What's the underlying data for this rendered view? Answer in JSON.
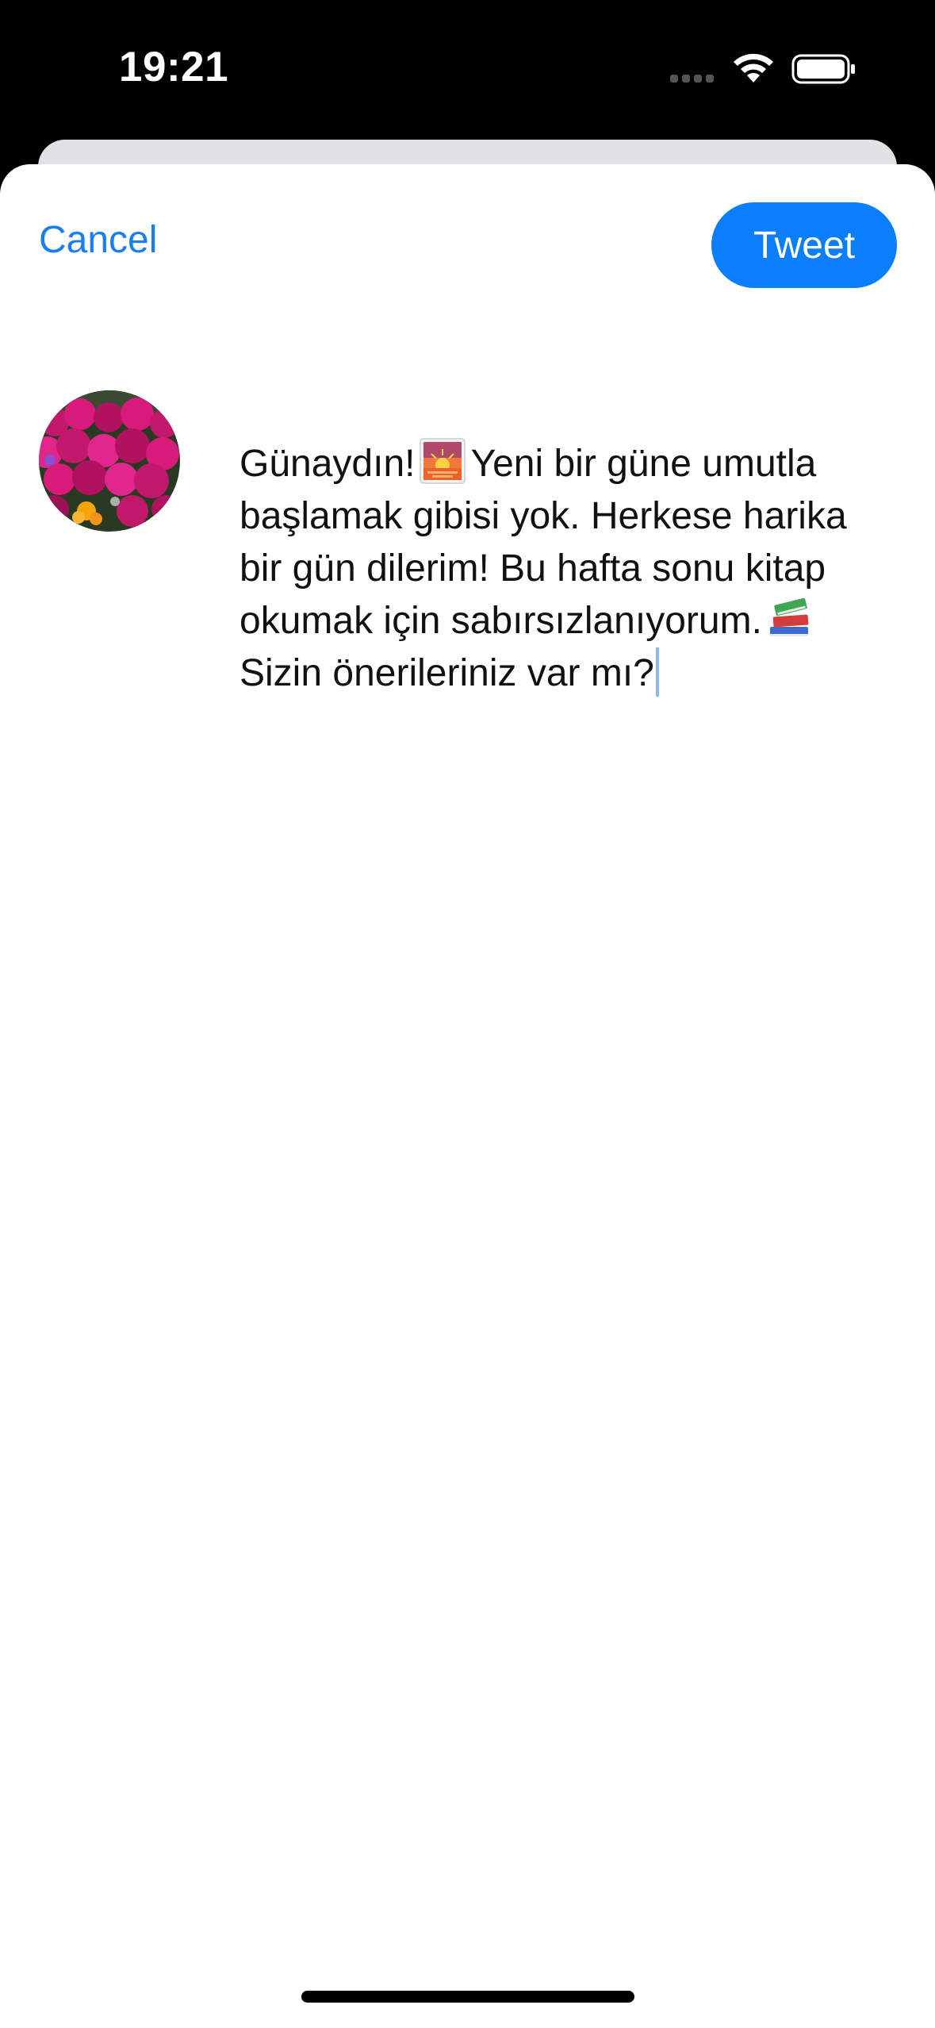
{
  "status_bar": {
    "time": "19:21",
    "icons": [
      "cellular-dots-icon",
      "wifi-icon",
      "battery-icon"
    ]
  },
  "composer": {
    "cancel_label": "Cancel",
    "tweet_label": "Tweet",
    "avatar_icon": "profile-avatar-flowers",
    "text_lines": [
      "Günaydın!",
      "Yeni bir güne umutla",
      "başlamak gibisi yok. Herkese harika",
      "bir gün dilerim! Bu hafta sonu kitap",
      "okumak için sabırsızlanıyorum.",
      "Sizin önerileriniz var mı?"
    ],
    "emojis": [
      "sunrise-emoji",
      "books-emoji"
    ]
  },
  "colors": {
    "accent": "#0a7efb",
    "link": "#1a7ef2",
    "background": "#ffffff",
    "status_bar": "#000000"
  }
}
